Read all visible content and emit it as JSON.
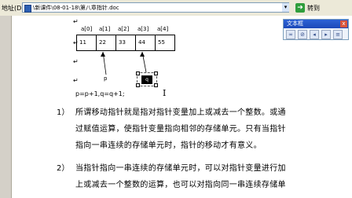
{
  "address_bar": {
    "label": "地址(D)",
    "path": "\\新课件\\08-01-18\\第八章指针.doc",
    "go_label": "转到"
  },
  "textbox_toolbar": {
    "title": "文本框",
    "close": "x"
  },
  "diagram": {
    "index_labels": [
      "a[0]",
      "a[1]",
      "a[2]",
      "a[3]",
      "a[4]"
    ],
    "cells": [
      "11",
      "22",
      "33",
      "44",
      "55"
    ],
    "pointer_p": "p",
    "pointer_q": "q"
  },
  "code_line": "p=p+1,q=q+1;",
  "items": [
    {
      "number": "1）",
      "lines": [
        "所谓移动指针就是指对指针变量加上或减去一个整数。或通",
        "过赋值运算，使指针变量指向相邻的存储单元。只有当指针",
        "指向一串连续的存储单元时，指针的移动才有意义。"
      ]
    },
    {
      "number": "2）",
      "lines": [
        "当指针指向一串连续的存储单元时，可以对指针变量进行加",
        "上或减去一个整数的运算，也可以对指向同一串连续存储单"
      ]
    }
  ]
}
